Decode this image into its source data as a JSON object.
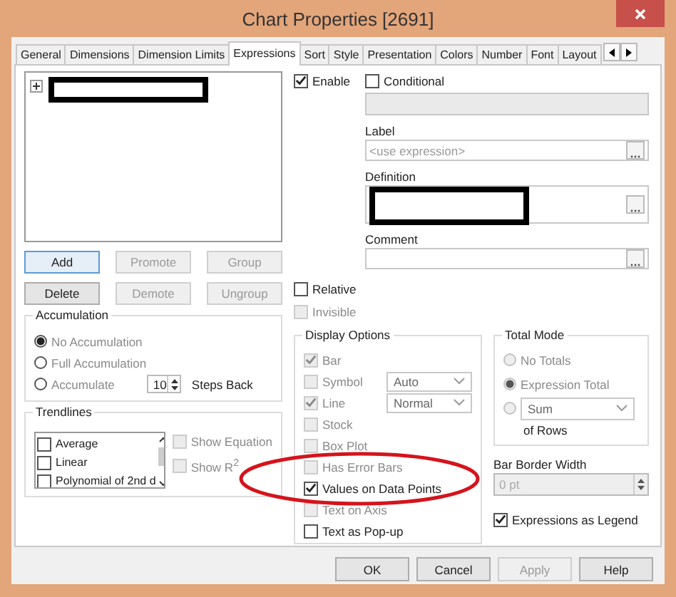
{
  "window": {
    "title": "Chart Properties [2691]"
  },
  "tabs": [
    {
      "label": "General",
      "selected": false
    },
    {
      "label": "Dimensions",
      "selected": false
    },
    {
      "label": "Dimension Limits",
      "selected": false
    },
    {
      "label": "Expressions",
      "selected": true
    },
    {
      "label": "Sort",
      "selected": false
    },
    {
      "label": "Style",
      "selected": false
    },
    {
      "label": "Presentation",
      "selected": false
    },
    {
      "label": "Colors",
      "selected": false
    },
    {
      "label": "Number",
      "selected": false
    },
    {
      "label": "Font",
      "selected": false
    },
    {
      "label": "Layout",
      "selected": false
    }
  ],
  "expression_tree": {
    "items": [
      {
        "expanded": false
      }
    ]
  },
  "expression_buttons": [
    {
      "label": "Add",
      "disabled": false
    },
    {
      "label": "Promote",
      "disabled": true
    },
    {
      "label": "Group",
      "disabled": true
    },
    {
      "label": "Delete",
      "disabled": false
    },
    {
      "label": "Demote",
      "disabled": true
    },
    {
      "label": "Ungroup",
      "disabled": true
    }
  ],
  "accumulation": {
    "title": "Accumulation",
    "options": [
      {
        "label": "No Accumulation",
        "selected": true
      },
      {
        "label": "Full Accumulation",
        "selected": false
      },
      {
        "label": "Accumulate",
        "selected": false
      }
    ],
    "steps_value": "10",
    "steps_label": "Steps Back"
  },
  "trendlines": {
    "title": "Trendlines",
    "items": [
      {
        "label": "Average",
        "checked": false
      },
      {
        "label": "Linear",
        "checked": false
      },
      {
        "label": "Polynomial of 2nd d",
        "checked": false
      }
    ],
    "options": [
      {
        "label": "Show Equation",
        "checked": false,
        "disabled": true
      },
      {
        "label": "Show R$^{2}$",
        "checked": false,
        "disabled": true
      }
    ]
  },
  "enable": {
    "label": "Enable",
    "checked": true
  },
  "conditional": {
    "label": "Conditional",
    "checked": false
  },
  "label_field": {
    "title": "Label",
    "placeholder": "<use expression>"
  },
  "definition_field": {
    "title": "Definition"
  },
  "comment_field": {
    "title": "Comment"
  },
  "flags": [
    {
      "label": "Relative",
      "checked": false,
      "disabled": false
    },
    {
      "label": "Invisible",
      "checked": false,
      "disabled": true
    }
  ],
  "display_options": {
    "title": "Display Options",
    "items": [
      {
        "label": "Bar",
        "checked": true,
        "disabled": true
      },
      {
        "label": "Symbol",
        "checked": false,
        "disabled": true,
        "dropdown": "Auto"
      },
      {
        "label": "Line",
        "checked": true,
        "disabled": true,
        "dropdown": "Normal"
      },
      {
        "label": "Stock",
        "checked": false,
        "disabled": true
      },
      {
        "label": "Box Plot",
        "checked": false,
        "disabled": true
      },
      {
        "label": "Has Error Bars",
        "checked": false,
        "disabled": true
      },
      {
        "label": "Values on Data Points",
        "checked": true,
        "disabled": false
      },
      {
        "label": "Text on Axis",
        "checked": false,
        "disabled": true
      },
      {
        "label": "Text as Pop-up",
        "checked": false,
        "disabled": false
      }
    ]
  },
  "total_mode": {
    "title": "Total Mode",
    "options": [
      {
        "label": "No Totals",
        "selected": false,
        "disabled": true
      },
      {
        "label": "Expression Total",
        "selected": true,
        "disabled": true
      },
      {
        "dropdown": "Sum",
        "selected": false,
        "disabled": true
      }
    ],
    "suffix": "of Rows"
  },
  "bar_border_width": {
    "title": "Bar Border Width",
    "value": "0 pt"
  },
  "expressions_as_legend": {
    "label": "Expressions as Legend",
    "checked": true
  },
  "footer_buttons": [
    {
      "label": "OK",
      "disabled": false
    },
    {
      "label": "Cancel",
      "disabled": false
    },
    {
      "label": "Apply",
      "disabled": true
    },
    {
      "label": "Help",
      "disabled": false
    }
  ]
}
